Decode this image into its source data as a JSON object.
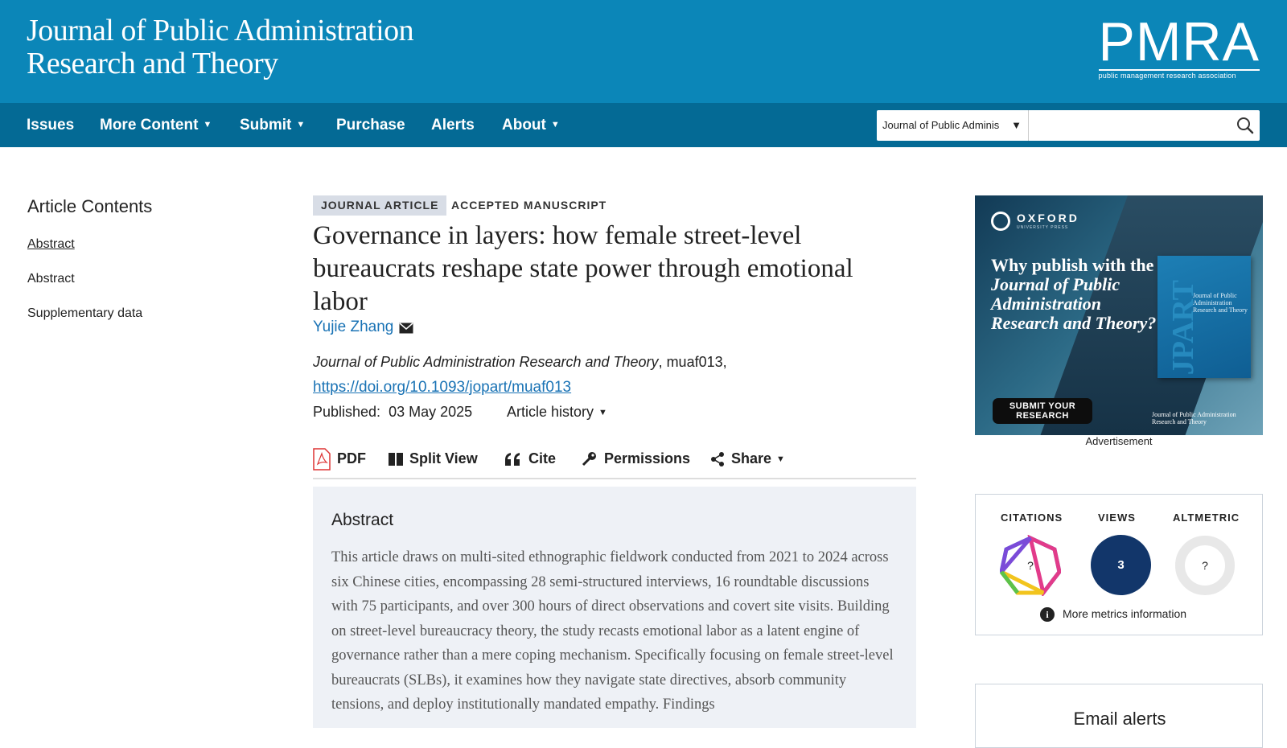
{
  "header": {
    "journal_title_line1": "Journal of Public Administration",
    "journal_title_line2": "Research and Theory",
    "logo_text": "PMRA",
    "logo_tagline": "public management research association"
  },
  "nav": {
    "items": [
      "Issues",
      "More Content",
      "Submit",
      "Purchase",
      "Alerts",
      "About"
    ],
    "search_scope": "Journal of Public Adminis",
    "search_placeholder": ""
  },
  "sidebar": {
    "title": "Article Contents",
    "items": [
      "Abstract",
      "Abstract",
      "Supplementary data"
    ]
  },
  "article": {
    "type_badge": "JOURNAL ARTICLE",
    "status_badge": "ACCEPTED MANUSCRIPT",
    "title": "Governance in layers: how female street-level bureaucrats reshape state power through emotional labor",
    "author": "Yujie Zhang",
    "journal_name": "Journal of Public Administration Research and Theory",
    "article_id": ", muaf013,",
    "doi": "https://doi.org/10.1093/jopart/muaf013",
    "published_label": "Published:",
    "published_date": "03 May 2025",
    "history_label": "Article history"
  },
  "toolbar": {
    "pdf": "PDF",
    "split_view": "Split View",
    "cite": "Cite",
    "permissions": "Permissions",
    "share": "Share"
  },
  "abstract": {
    "heading": "Abstract",
    "text": "This article draws on multi-sited ethnographic fieldwork conducted from 2021 to 2024 across six Chinese cities, encompassing 28 semi-structured interviews, 16 roundtable discussions with 75 participants, and over 300 hours of direct observations and covert site visits. Building on street-level bureaucracy theory, the study recasts emotional labor as a latent engine of governance rather than a mere coping mechanism. Specifically focusing on female street-level bureaucrats (SLBs), it examines how they navigate state directives, absorb community tensions, and deploy institutionally mandated empathy. Findings"
  },
  "ad": {
    "publisher": "OXFORD",
    "publisher_sub": "UNIVERSITY PRESS",
    "headline_plain": "Why publish with the",
    "headline_italic": "Journal of Public Administration Research and Theory?",
    "button_line1": "SUBMIT YOUR",
    "button_line2": "RESEARCH",
    "book_spine": "JPART",
    "book_title": "Journal of Public Administration Research and Theory",
    "footer_line1": "Journal of Public Administration",
    "footer_line2": "Research and Theory",
    "label": "Advertisement"
  },
  "metrics": {
    "citations_label": "CITATIONS",
    "citations_value": "?",
    "views_label": "VIEWS",
    "views_value": "3",
    "altmetric_label": "ALTMETRIC",
    "altmetric_value": "?",
    "more_link": "More metrics information",
    "info_glyph": "i"
  },
  "email_alerts": {
    "title": "Email alerts"
  },
  "colors": {
    "header_bg": "#0b86b8",
    "nav_bg": "#046a95",
    "link": "#1a73b5",
    "views_circle": "#12366a",
    "abstract_bg": "#eef1f6"
  }
}
